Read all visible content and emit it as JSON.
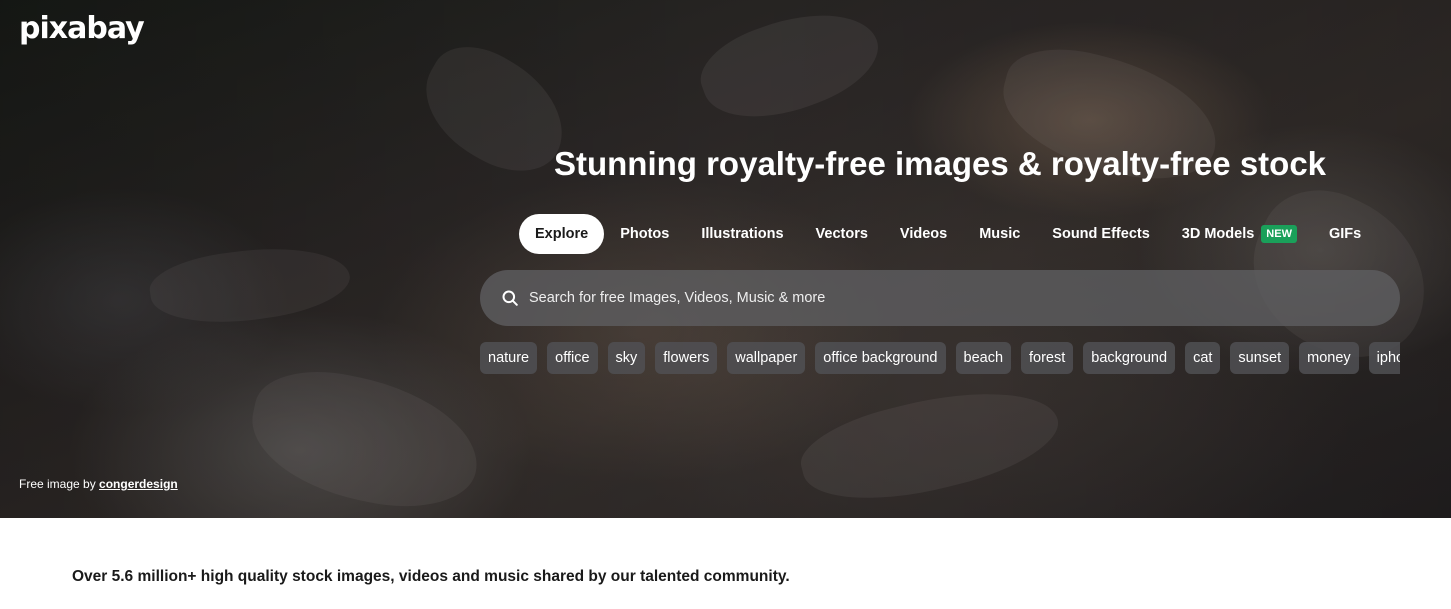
{
  "brand": {
    "logo_text": "pixabay"
  },
  "hero": {
    "headline": "Stunning royalty-free images & royalty-free stock",
    "credit": {
      "prefix": "Free image by",
      "author": "congerdesign"
    }
  },
  "tabs": [
    {
      "label": "Explore",
      "active": true
    },
    {
      "label": "Photos"
    },
    {
      "label": "Illustrations"
    },
    {
      "label": "Vectors"
    },
    {
      "label": "Videos"
    },
    {
      "label": "Music"
    },
    {
      "label": "Sound Effects"
    },
    {
      "label": "3D Models",
      "badge": "NEW"
    },
    {
      "label": "GIFs"
    }
  ],
  "search": {
    "placeholder": "Search for free Images, Videos, Music & more",
    "icon": "search-icon"
  },
  "suggestions": [
    "nature",
    "office",
    "sky",
    "flowers",
    "wallpaper",
    "office background",
    "beach",
    "forest",
    "background",
    "cat",
    "sunset",
    "money",
    "iphone"
  ],
  "tagline": "Over 5.6 million+ high quality stock images, videos and music shared by our talented community.",
  "colors": {
    "badge_green": "#1aa05a",
    "active_tab_bg": "#ffffff",
    "text_dark": "#1a1a1a"
  }
}
